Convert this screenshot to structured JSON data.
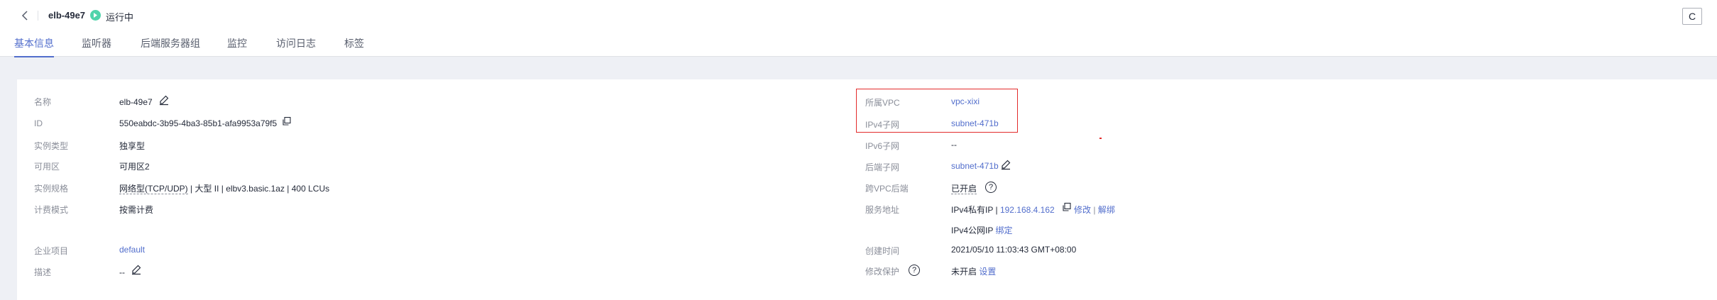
{
  "header": {
    "title": "elb-49e7",
    "status": "运行中",
    "refresh_icon": "C"
  },
  "tabs": [
    {
      "label": "基本信息",
      "active": true
    },
    {
      "label": "监听器"
    },
    {
      "label": "后端服务器组"
    },
    {
      "label": "监控"
    },
    {
      "label": "访问日志"
    },
    {
      "label": "标签"
    }
  ],
  "left": {
    "name_label": "名称",
    "name_value": "elb-49e7",
    "id_label": "ID",
    "id_value": "550eabdc-3b95-4ba3-85b1-afa9953a79f5",
    "type_label": "实例类型",
    "type_value": "独享型",
    "az_label": "可用区",
    "az_value": "可用区2",
    "spec_label": "实例规格",
    "spec_value_dotted": "网络型(TCP/UDP)",
    "spec_value_rest": " | 大型 II | elbv3.basic.1az | 400 LCUs",
    "billing_label": "计费模式",
    "billing_value": "按需计费",
    "project_label": "企业项目",
    "project_value": "default",
    "desc_label": "描述",
    "desc_value": "--"
  },
  "right": {
    "vpc_label": "所属VPC",
    "vpc_value": "vpc-xixi",
    "ipv4_subnet_label": "IPv4子网",
    "ipv4_subnet_value": "subnet-471b",
    "ipv6_subnet_label": "IPv6子网",
    "ipv6_subnet_value": "--",
    "backend_subnet_label": "后端子网",
    "backend_subnet_value": "subnet-471b",
    "cross_vpc_label": "跨VPC后端",
    "cross_vpc_value": "已开启",
    "service_addr_label": "服务地址",
    "private_ip_label": "IPv4私有IP",
    "private_ip_sep": "|",
    "private_ip_value": "192.168.4.162",
    "modify_link": "修改",
    "sep2": "|",
    "unbind_link": "解绑",
    "public_ip_label": "IPv4公网IP",
    "bind_link": "绑定",
    "created_label": "创建时间",
    "created_value": "2021/05/10 11:03:43 GMT+08:00",
    "protect_label": "修改保护",
    "protect_value": "未开启",
    "settings_link": "设置",
    "qmark": "?"
  },
  "colors": {
    "accent": "#526ecc",
    "status_green": "#50d4ab",
    "highlight_red": "#e32b2b"
  }
}
